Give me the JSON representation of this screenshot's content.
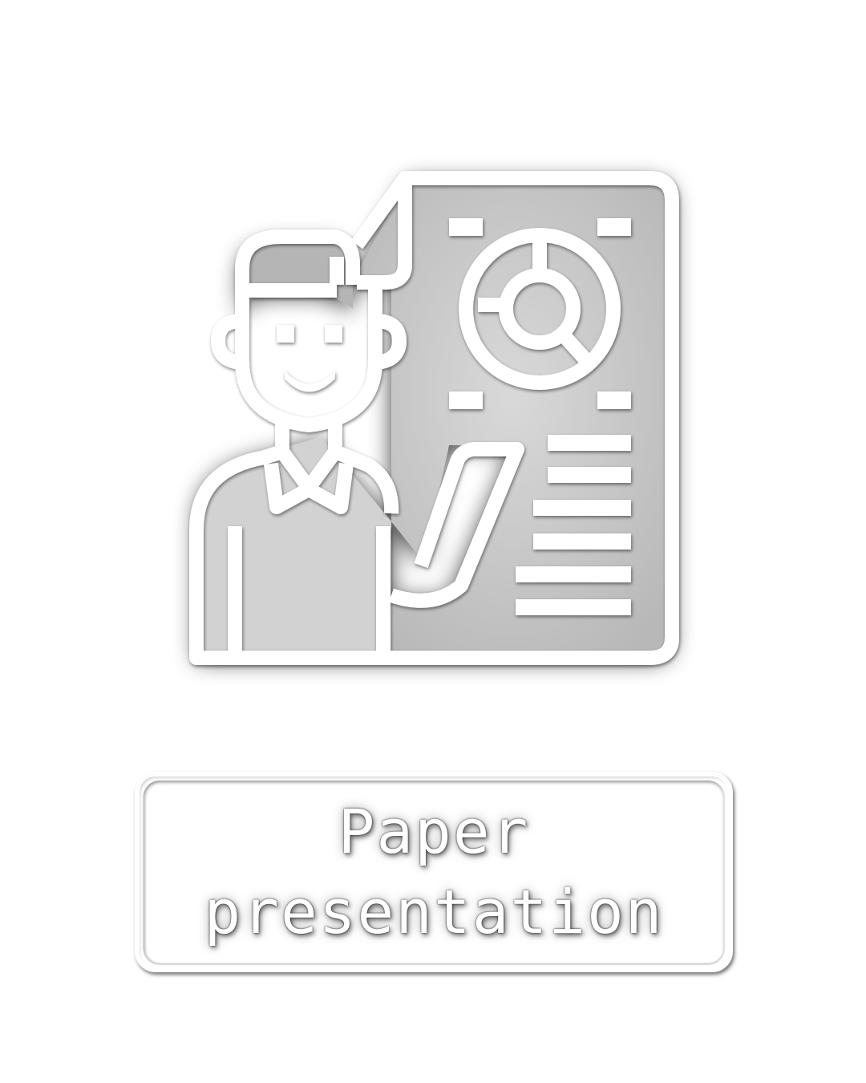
{
  "icon": {
    "name": "paper-presentation-icon",
    "color": "#ffffff",
    "shadow_color": "#000000"
  },
  "label": {
    "line1": "Paper",
    "line2": "presentation"
  }
}
